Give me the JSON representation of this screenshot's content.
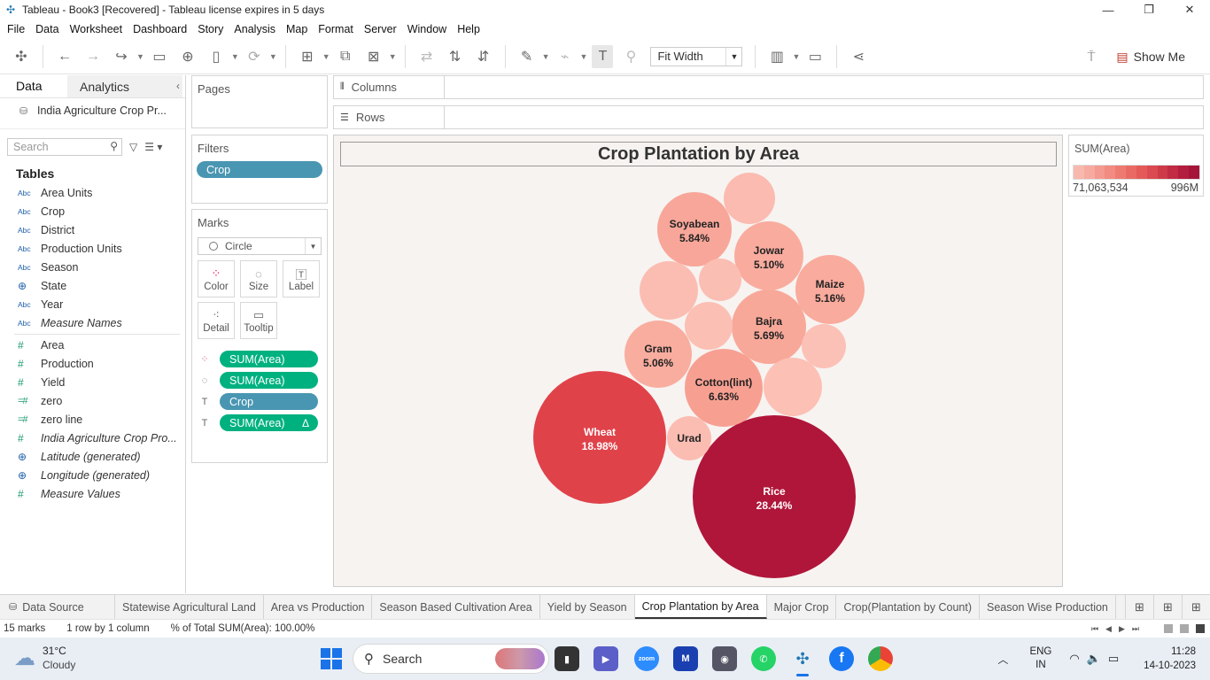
{
  "window": {
    "title": "Tableau - Book3 [Recovered] - Tableau license expires in 5 days",
    "minimize_icon": "minimize-icon",
    "restore_icon": "restore-icon",
    "close_icon": "close-icon"
  },
  "menu": [
    "File",
    "Data",
    "Worksheet",
    "Dashboard",
    "Story",
    "Analysis",
    "Map",
    "Format",
    "Server",
    "Window",
    "Help"
  ],
  "toolbar": {
    "fit": "Fit Width",
    "show_me": "Show Me"
  },
  "data_pane": {
    "tab_data": "Data",
    "tab_analytics": "Analytics",
    "source": "India Agriculture Crop Pr...",
    "search_placeholder": "Search",
    "tables_heading": "Tables",
    "dimensions": [
      {
        "type": "Abc",
        "name": "Area Units"
      },
      {
        "type": "Abc",
        "name": "Crop"
      },
      {
        "type": "Abc",
        "name": "District"
      },
      {
        "type": "Abc",
        "name": "Production Units"
      },
      {
        "type": "Abc",
        "name": "Season"
      },
      {
        "type": "globe",
        "name": "State"
      },
      {
        "type": "Abc",
        "name": "Year"
      },
      {
        "type": "Abc",
        "name": "Measure Names"
      }
    ],
    "measures": [
      {
        "type": "#",
        "name": "Area"
      },
      {
        "type": "#",
        "name": "Production"
      },
      {
        "type": "#",
        "name": "Yield"
      },
      {
        "type": "=#",
        "name": "zero"
      },
      {
        "type": "=#",
        "name": "zero line"
      },
      {
        "type": "#",
        "name": "India Agriculture Crop Pro..."
      },
      {
        "type": "globe",
        "name": "Latitude (generated)"
      },
      {
        "type": "globe",
        "name": "Longitude (generated)"
      },
      {
        "type": "#",
        "name": "Measure Values"
      }
    ]
  },
  "cards": {
    "pages_title": "Pages",
    "filters_title": "Filters",
    "filter_pill": "Crop",
    "marks_title": "Marks",
    "mark_type": "Circle",
    "buttons": [
      "Color",
      "Size",
      "Label",
      "Detail",
      "Tooltip"
    ],
    "mark_pills": [
      "SUM(Area)",
      "SUM(Area)",
      "Crop",
      "SUM(Area)"
    ],
    "delta": "Δ"
  },
  "shelves": {
    "columns": "Columns",
    "rows": "Rows"
  },
  "viz": {
    "title": "Crop Plantation by Area"
  },
  "legend": {
    "title": "SUM(Area)",
    "min": "71,063,534",
    "max": "996M",
    "colors": [
      "#f8b8ae",
      "#f6aaa0",
      "#f49a90",
      "#f28b81",
      "#ee7b72",
      "#e96a65",
      "#e35a59",
      "#da4a50",
      "#cf3a49",
      "#c22b43",
      "#b41e3e",
      "#a5153a"
    ]
  },
  "chart_data": {
    "type": "packed-bubble",
    "title": "Crop Plantation by Area",
    "measure": "SUM(Area)",
    "label_format": "% of Total SUM(Area)",
    "bubbles": [
      {
        "crop": "Rice",
        "share": "28.44%",
        "color": "#b0163a"
      },
      {
        "crop": "Wheat",
        "share": "18.98%",
        "color": "#e0424a"
      },
      {
        "crop": "Cotton(lint)",
        "share": "6.63%",
        "color": "#f7a092"
      },
      {
        "crop": "Soyabean",
        "share": "5.84%",
        "color": "#f8a699"
      },
      {
        "crop": "Bajra",
        "share": "5.69%",
        "color": "#f8a899"
      },
      {
        "crop": "Maize",
        "share": "5.16%",
        "color": "#f9ab9d"
      },
      {
        "crop": "Jowar",
        "share": "5.10%",
        "color": "#f9ac9e"
      },
      {
        "crop": "Gram",
        "share": "5.06%",
        "color": "#f9ad9f"
      },
      {
        "crop": "Urad",
        "share": "",
        "color": "#fbbdb2"
      },
      {
        "crop": "",
        "share": "",
        "color": "#fbbbb0"
      },
      {
        "crop": "",
        "share": "",
        "color": "#fbbdb2"
      },
      {
        "crop": "",
        "share": "",
        "color": "#fbbeb3"
      },
      {
        "crop": "",
        "share": "",
        "color": "#fbbfb4"
      },
      {
        "crop": "",
        "share": "",
        "color": "#fcc0b5"
      },
      {
        "crop": "",
        "share": "",
        "color": "#fcc1b6"
      }
    ]
  },
  "sheet_tabs": {
    "data_source": "Data Source",
    "tabs": [
      "Statewise Agricultural Land",
      "Area vs Production",
      "Season Based Cultivation Area",
      "Yield by Season",
      "Crop Plantation by Area",
      "Major Crop",
      "Crop(Plantation by Count)",
      "Season Wise Production"
    ],
    "active": "Crop Plantation by Area"
  },
  "status": {
    "marks": "15 marks",
    "dims": "1 row by 1 column",
    "total": "% of Total SUM(Area): 100.00%"
  },
  "taskbar": {
    "temp": "31°C",
    "weather": "Cloudy",
    "search": "Search",
    "lang1": "ENG",
    "lang2": "IN",
    "time": "11:28",
    "date": "14-10-2023"
  }
}
